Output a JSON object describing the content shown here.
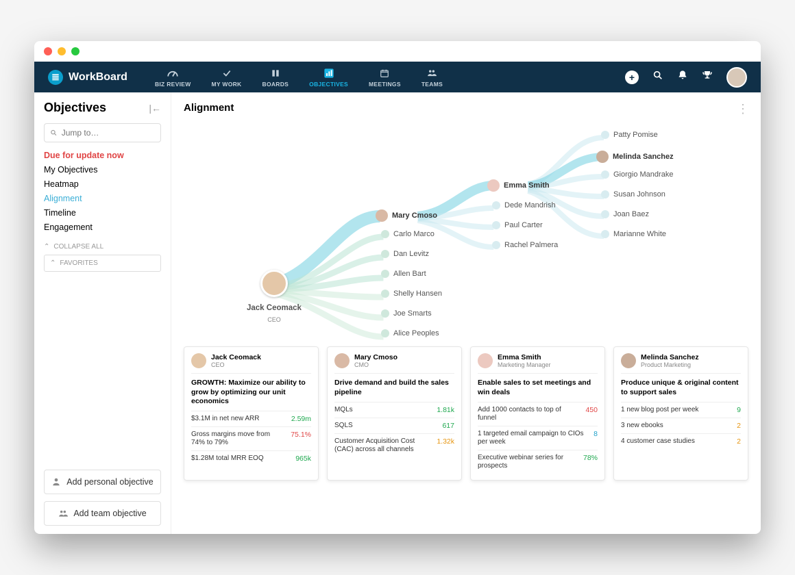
{
  "app_name": "WorkBoard",
  "nav": [
    {
      "label": "BIZ REVIEW",
      "icon": "gauge"
    },
    {
      "label": "MY WORK",
      "icon": "check"
    },
    {
      "label": "BOARDS",
      "icon": "columns"
    },
    {
      "label": "OBJECTIVES",
      "icon": "chart",
      "active": true
    },
    {
      "label": "MEETINGS",
      "icon": "calendar"
    },
    {
      "label": "TEAMS",
      "icon": "people"
    }
  ],
  "sidebar": {
    "title": "Objectives",
    "search_placeholder": "Jump to…",
    "items": [
      {
        "label": "Due for update now",
        "kind": "urgent"
      },
      {
        "label": "My Objectives"
      },
      {
        "label": "Heatmap"
      },
      {
        "label": "Alignment",
        "kind": "active"
      },
      {
        "label": "Timeline"
      },
      {
        "label": "Engagement"
      }
    ],
    "collapse_all": "COLLAPSE ALL",
    "favorites": "FAVORITES",
    "add_personal": "Add personal objective",
    "add_team": "Add team objective"
  },
  "page_title": "Alignment",
  "tree": {
    "root": {
      "name": "Jack Ceomack",
      "role": "CEO"
    },
    "l2_main": {
      "name": "Mary Cmoso"
    },
    "l2": [
      "Carlo Marco",
      "Dan Levitz",
      "Allen Bart",
      "Shelly Hansen",
      "Joe Smarts",
      "Alice Peoples"
    ],
    "l3_main": {
      "name": "Emma Smith"
    },
    "l3": [
      "Dede Mandrish",
      "Paul Carter",
      "Rachel Palmera"
    ],
    "l4_main": {
      "name": "Melinda Sanchez"
    },
    "l4": [
      "Patty Pomise",
      "Giorgio Mandrake",
      "Susan Johnson",
      "Joan Baez",
      "Marianne White"
    ]
  },
  "cards": [
    {
      "name": "Jack Ceomack",
      "role": "CEO",
      "avatar": "#e4c7a8",
      "objective": "GROWTH: Maximize our ability to grow by optimizing our unit economics",
      "krs": [
        {
          "label": "$3.1M in net new ARR",
          "value": "2.59m",
          "color": "green"
        },
        {
          "label": "Gross margins move from 74% to 79%",
          "value": "75.1%",
          "color": "red"
        },
        {
          "label": "$1.28M total MRR EOQ",
          "value": "965k",
          "color": "green"
        }
      ]
    },
    {
      "name": "Mary Cmoso",
      "role": "CMO",
      "avatar": "#d9b9a5",
      "objective": "Drive demand and build the sales pipeline",
      "krs": [
        {
          "label": "MQLs",
          "value": "1.81k",
          "color": "green"
        },
        {
          "label": "SQLS",
          "value": "617",
          "color": "green"
        },
        {
          "label": "Customer Acquisition Cost (CAC) across all channels",
          "value": "1.32k",
          "color": "orange"
        }
      ]
    },
    {
      "name": "Emma Smith",
      "role": "Marketing Manager",
      "avatar": "#ecc9c0",
      "objective": "Enable sales to set meetings and win deals",
      "krs": [
        {
          "label": "Add 1000 contacts to top of funnel",
          "value": "450",
          "color": "red"
        },
        {
          "label": "1 targeted email campaign to CIOs per week",
          "value": "8",
          "color": "blue"
        },
        {
          "label": "Executive webinar series for prospects",
          "value": "78%",
          "color": "green"
        }
      ]
    },
    {
      "name": "Melinda Sanchez",
      "role": "Product Marketing",
      "avatar": "#c9ad99",
      "objective": "Produce unique & original content to support sales",
      "krs": [
        {
          "label": "1 new blog post per week",
          "value": "9",
          "color": "green"
        },
        {
          "label": "3 new ebooks",
          "value": "2",
          "color": "orange"
        },
        {
          "label": "4 customer case studies",
          "value": "2",
          "color": "orange"
        }
      ]
    }
  ]
}
